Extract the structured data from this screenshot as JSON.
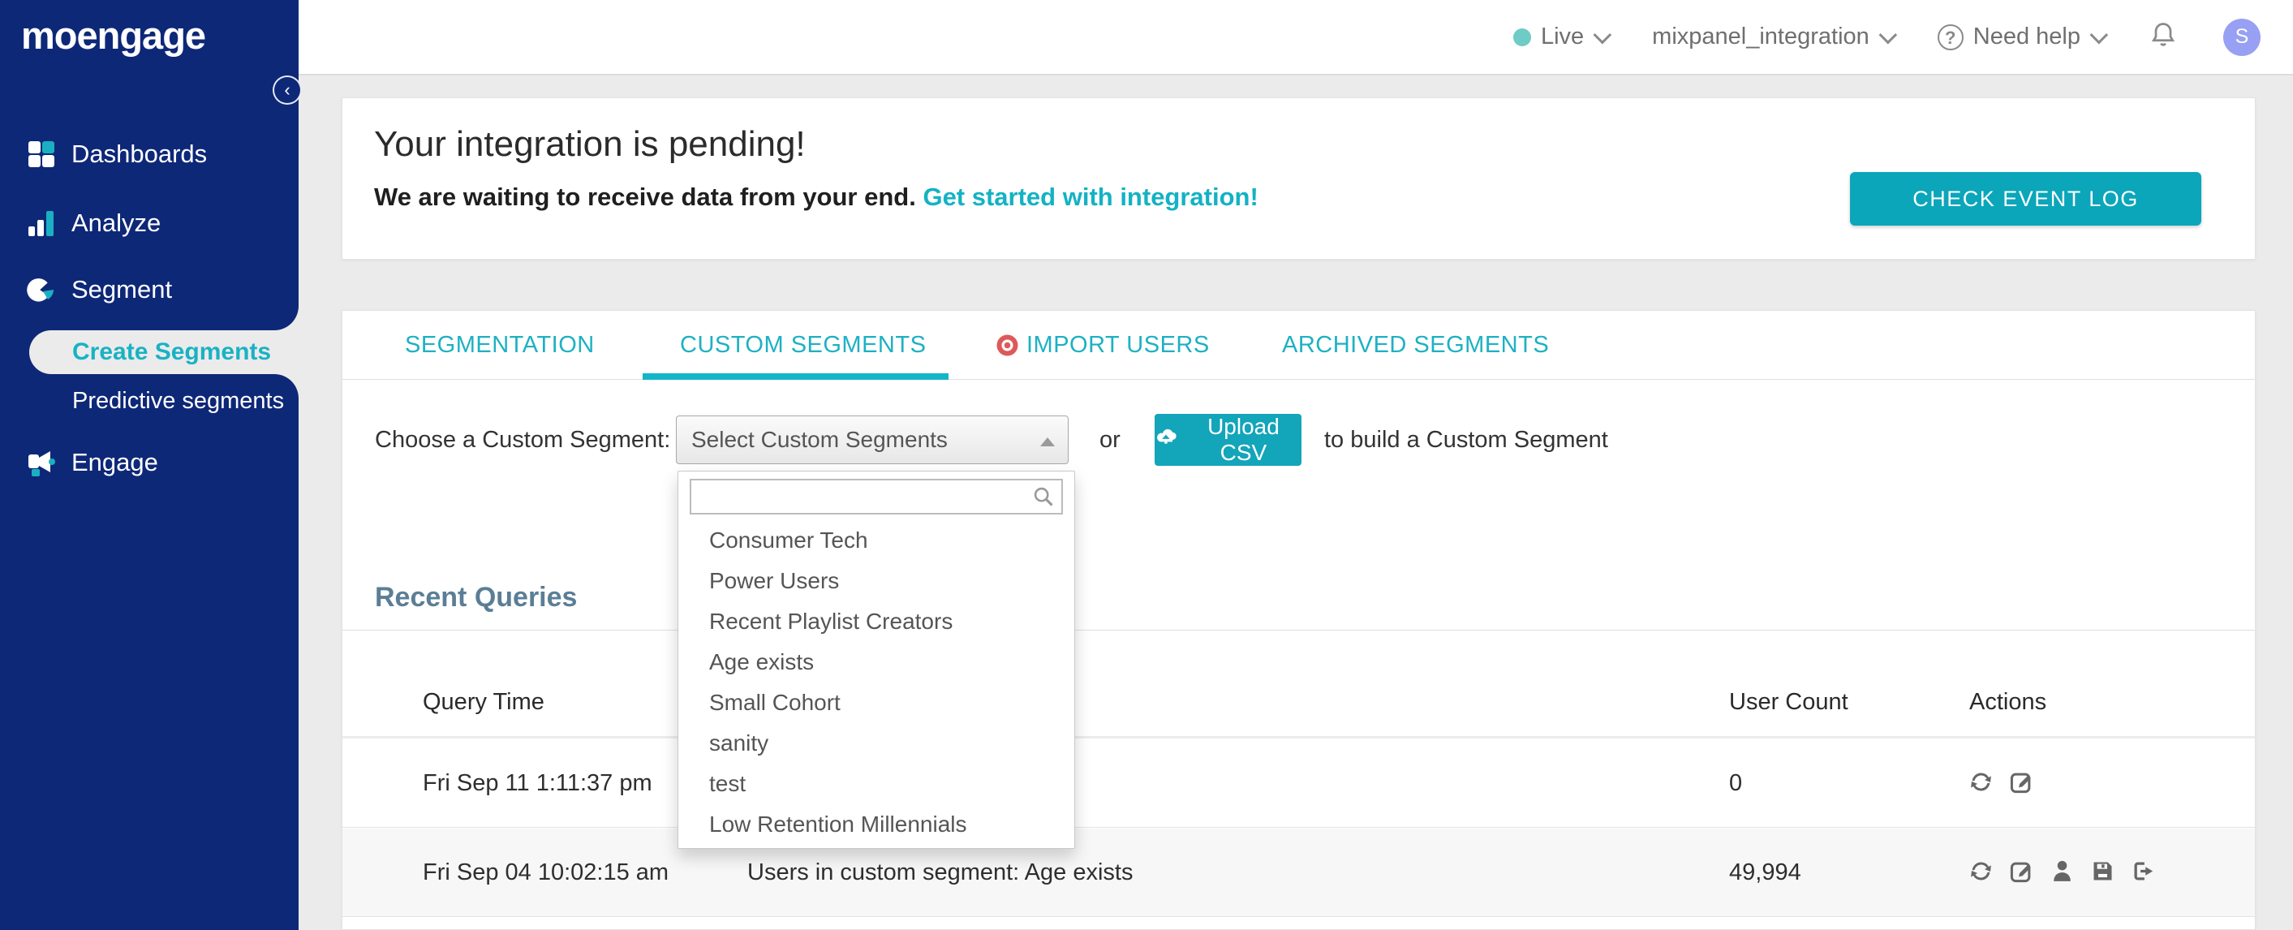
{
  "colors": {
    "accent_teal": "#13b5c7",
    "button_teal": "#0ba6ba",
    "sidebar_navy": "#0e2878",
    "heading_slate": "#5b7e96",
    "import_dot_red": "#dd5a5a",
    "live_dot": "#6fcbc5",
    "avatar_bg": "#97a0f3",
    "row_alt_bg": "#f7f7f7"
  },
  "brand": {
    "logo_text": "moengage"
  },
  "topbar": {
    "environment": {
      "label": "Live"
    },
    "project": {
      "label": "mixpanel_integration"
    },
    "help": {
      "label": "Need help"
    },
    "avatar": {
      "initial": "S"
    }
  },
  "sidebar": {
    "items": [
      {
        "label": "Dashboards",
        "icon": "dashboards-icon"
      },
      {
        "label": "Analyze",
        "icon": "analyze-icon"
      },
      {
        "label": "Segment",
        "icon": "segment-icon"
      },
      {
        "label": "Engage",
        "icon": "engage-icon"
      }
    ],
    "segment_children": [
      {
        "label": "Create Segments",
        "active": true
      },
      {
        "label": "Predictive segments",
        "active": false
      }
    ]
  },
  "banner": {
    "title": "Your integration is pending!",
    "subtitle": "We are waiting to receive data from your end. ",
    "link_text": "Get started with integration!",
    "button_label": "CHECK EVENT LOG"
  },
  "tabs": [
    {
      "label": "SEGMENTATION",
      "active": false
    },
    {
      "label": "CUSTOM SEGMENTS",
      "active": true
    },
    {
      "label": "IMPORT USERS",
      "active": false,
      "icon": "record-dot-icon"
    },
    {
      "label": "ARCHIVED SEGMENTS",
      "active": false
    }
  ],
  "segment_picker": {
    "label": "Choose a Custom Segment:",
    "select_value": "Select Custom Segments",
    "search_value": "",
    "or_text": "or",
    "upload_button_label": "Upload CSV",
    "suffix_text": "to build a Custom Segment",
    "options": [
      "Consumer Tech",
      "Power Users",
      "Recent Playlist Creators",
      "Age exists",
      "Small Cohort",
      "sanity",
      "test",
      "Low Retention Millennials"
    ]
  },
  "recent_queries": {
    "title": "Recent Queries",
    "columns": {
      "time": "Query Time",
      "count": "User Count",
      "actions": "Actions"
    },
    "rows": [
      {
        "query_time": "Fri Sep 11 1:11:37 pm",
        "query": "",
        "user_count": "0",
        "actions": [
          "refresh",
          "edit"
        ]
      },
      {
        "query_time": "Fri Sep 04 10:02:15 am",
        "query": "Users in custom segment: Age exists",
        "user_count": "49,994",
        "actions": [
          "refresh",
          "edit",
          "user",
          "save",
          "export"
        ]
      }
    ]
  }
}
